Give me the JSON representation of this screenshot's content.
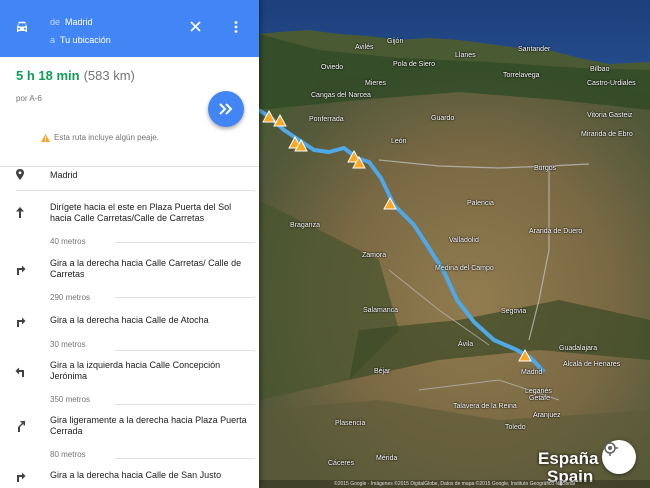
{
  "header": {
    "from_prefix": "de",
    "from_value": "Madrid",
    "to_prefix": "a",
    "to_value": "Tu ubicación"
  },
  "summary": {
    "duration": "5 h 18 min",
    "distance": "(583 km)",
    "via": "por A-6",
    "toll_notice": "Esta ruta incluye algún peaje."
  },
  "steps": [
    {
      "text": "Madrid",
      "distance": "",
      "icon": "location-pin-icon"
    },
    {
      "text": "Dirígete hacia el este en Plaza Puerta del Sol hacia Calle Carretas/Calle de Carretas",
      "distance": "40 metros",
      "icon": "arrow-up-icon"
    },
    {
      "text": "Gira a la derecha hacia Calle Carretas/ Calle de Carretas",
      "distance": "290 metros",
      "icon": "turn-right-icon"
    },
    {
      "text": "Gira a la derecha hacia Calle de Atocha",
      "distance": "30 metros",
      "icon": "turn-right-icon"
    },
    {
      "text": "Gira a la izquierda hacia Calle Concepción Jerónima",
      "distance": "350 metros",
      "icon": "turn-left-icon"
    },
    {
      "text": "Gira ligeramente a la derecha hacia Plaza Puerta Cerrada",
      "distance": "80 metros",
      "icon": "slight-right-icon"
    },
    {
      "text": "Gira a la derecha hacia Calle de San Justo",
      "distance": "",
      "icon": "turn-right-icon"
    }
  ],
  "map": {
    "labels": [
      "Gijón",
      "Avilés",
      "Llanes",
      "Santander",
      "Oviedo",
      "Pola de Siero",
      "Bilbao",
      "Mieres",
      "Torrelavega",
      "Castro-Urdiales",
      "Cangas del Narcea",
      "Vitoria Gasteiz",
      "Guardo",
      "Miranda de Ebro",
      "Ponferrada",
      "León",
      "Burgos",
      "Palencia",
      "Aranda de Duero",
      "Valladolid",
      "Braganza",
      "Zamora",
      "Medina del Campo",
      "Segovia",
      "Salamanca",
      "Ávila",
      "Guadalajara",
      "Madrid",
      "Alcalá de Henares",
      "Getafe",
      "Leganés",
      "Talavera de la Reina",
      "Aranjuez",
      "Béjar",
      "Plasencia",
      "Toledo",
      "Cáceres",
      "Mérida"
    ],
    "country_es": "España",
    "country_en": "Spain",
    "attribution": "©2015 Google · Imágenes ©2015 DigitalGlobe, Datos de mapa ©2015 Google, Instituto Geográfico Nacional",
    "route_color": "#4fa8e8"
  }
}
